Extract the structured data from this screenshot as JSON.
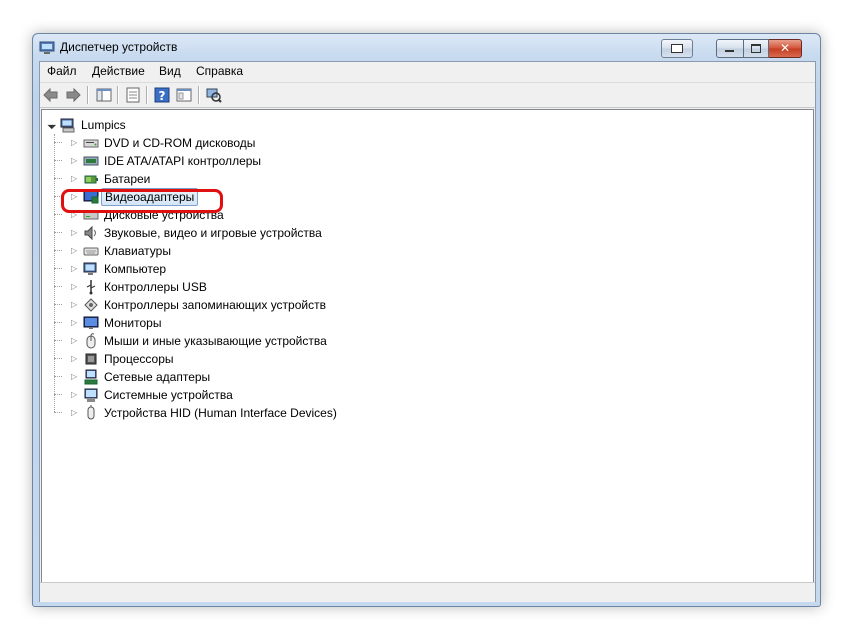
{
  "window": {
    "title": "Диспетчер устройств"
  },
  "menu": [
    "Файл",
    "Действие",
    "Вид",
    "Справка"
  ],
  "toolbar": {
    "buttons": [
      "back-icon",
      "forward-icon",
      "console-tree-icon",
      "properties-icon",
      "help-icon",
      "view-icon",
      "scan-hardware-icon"
    ]
  },
  "tree": {
    "root": "Lumpics",
    "selected_index": 3,
    "categories": [
      {
        "label": "DVD и CD-ROM дисководы",
        "icon": "dvd-drive-icon"
      },
      {
        "label": "IDE ATA/ATAPI контроллеры",
        "icon": "ide-controller-icon"
      },
      {
        "label": "Батареи",
        "icon": "battery-icon"
      },
      {
        "label": "Видеоадаптеры",
        "icon": "display-adapter-icon"
      },
      {
        "label": "Дисковые устройства",
        "icon": "disk-drive-icon"
      },
      {
        "label": "Звуковые, видео и игровые устройства",
        "icon": "speaker-icon"
      },
      {
        "label": "Клавиатуры",
        "icon": "keyboard-icon"
      },
      {
        "label": "Компьютер",
        "icon": "computer-icon"
      },
      {
        "label": "Контроллеры USB",
        "icon": "usb-icon"
      },
      {
        "label": "Контроллеры запоминающих устройств",
        "icon": "storage-controller-icon"
      },
      {
        "label": "Мониторы",
        "icon": "monitor-icon"
      },
      {
        "label": "Мыши и иные указывающие устройства",
        "icon": "mouse-icon"
      },
      {
        "label": "Процессоры",
        "icon": "processor-icon"
      },
      {
        "label": "Сетевые адаптеры",
        "icon": "network-adapter-icon"
      },
      {
        "label": "Системные устройства",
        "icon": "system-device-icon"
      },
      {
        "label": "Устройства HID (Human Interface Devices)",
        "icon": "hid-icon"
      }
    ]
  },
  "colors": {
    "highlight": "#e01010",
    "selection": "#d4e5f7"
  }
}
